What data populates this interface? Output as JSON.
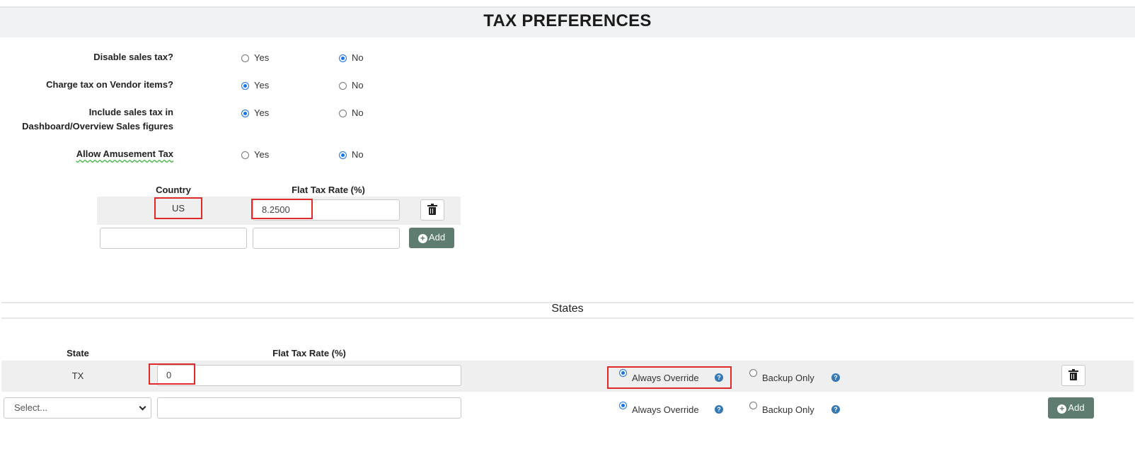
{
  "page": {
    "title": "TAX PREFERENCES"
  },
  "preferences": [
    {
      "label": "Disable sales tax?",
      "options": [
        "Yes",
        "No"
      ],
      "selected": "No"
    },
    {
      "label": "Charge tax on Vendor items?",
      "options": [
        "Yes",
        "No"
      ],
      "selected": "Yes"
    },
    {
      "label_line1": "Include sales tax in",
      "label_line2": "Dashboard/Overview Sales figures",
      "options": [
        "Yes",
        "No"
      ],
      "selected": "Yes"
    },
    {
      "label": "Allow Amusement Tax",
      "options": [
        "Yes",
        "No"
      ],
      "selected": "No"
    }
  ],
  "country_table": {
    "headers": {
      "country": "Country",
      "rate": "Flat Tax Rate (%)"
    },
    "rows": [
      {
        "country": "US",
        "rate": "8.2500"
      }
    ],
    "new_row": {
      "country": "",
      "rate": "",
      "add_label": "Add"
    }
  },
  "states_section": {
    "title": "States",
    "headers": {
      "state": "State",
      "rate": "Flat Tax Rate (%)"
    },
    "rows": [
      {
        "state": "TX",
        "rate": "0",
        "override_options": [
          "Always Override",
          "Backup Only"
        ],
        "selected": "Always Override"
      }
    ],
    "new_row": {
      "select_value": "Select...",
      "rate": "",
      "override_options": [
        "Always Override",
        "Backup Only"
      ],
      "selected": "Always Override",
      "add_label": "Add"
    }
  },
  "icons": {
    "delete": "trash-icon",
    "add": "plus-circle-icon",
    "help": "question-circle-icon",
    "dropdown": "chevron-down-icon"
  },
  "colors": {
    "accent": "#1a73e8",
    "add_button": "#5e7d70",
    "help": "#3478b5",
    "highlight": "#e12a2a"
  }
}
